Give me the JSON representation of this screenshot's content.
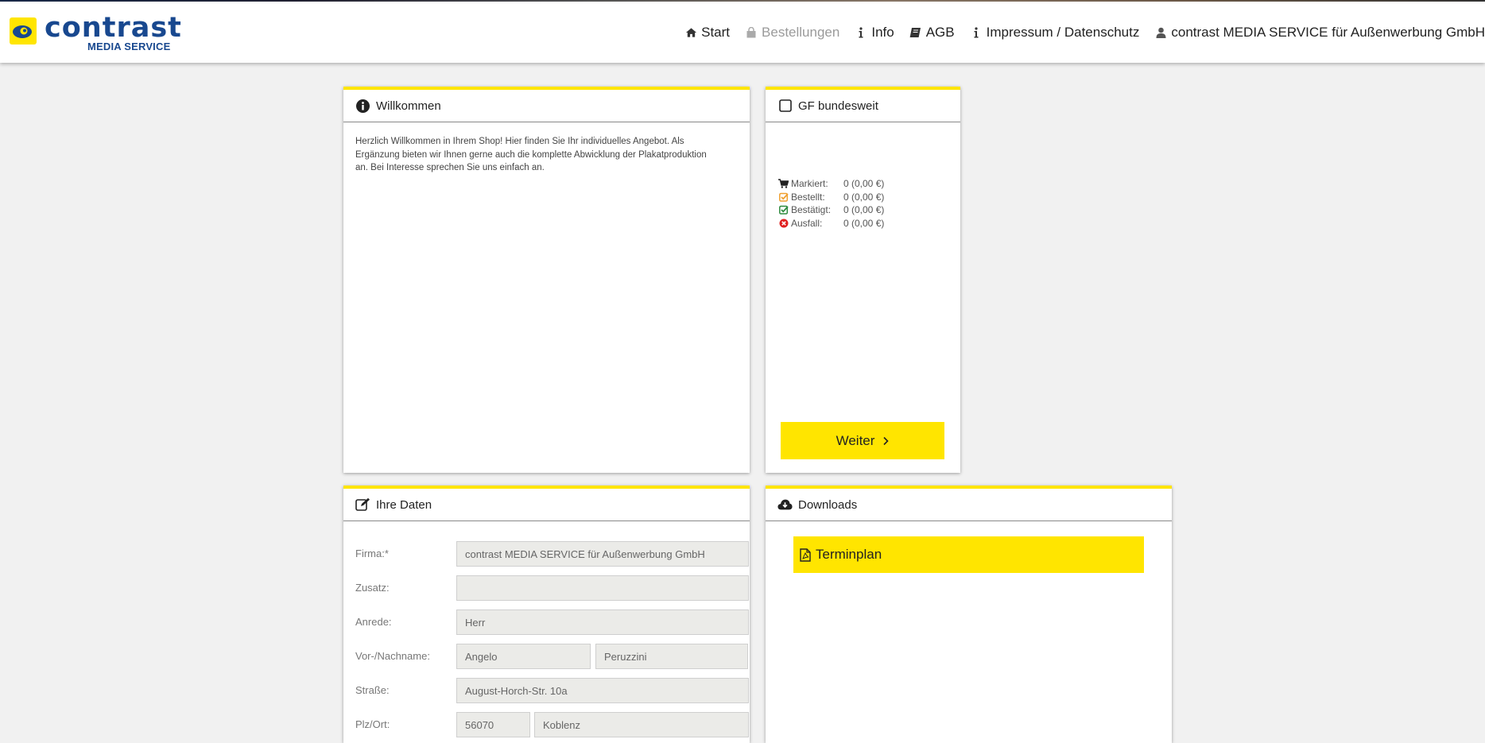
{
  "logo": {
    "word": "contrast",
    "sub": "MEDIA SERVICE"
  },
  "nav": {
    "items": [
      {
        "label": "Start",
        "icon": "home-icon"
      },
      {
        "label": "Bestellungen",
        "icon": "shopping-bag-icon"
      },
      {
        "label": "Info",
        "icon": "info-icon"
      },
      {
        "label": "AGB",
        "icon": "book-icon"
      },
      {
        "label": "Impressum / Datenschutz",
        "icon": "info-icon"
      },
      {
        "label": "contrast MEDIA SERVICE für Außenwerbung GmbH",
        "icon": "user-icon"
      }
    ]
  },
  "welcome": {
    "title": "Willkommen",
    "text": "Herzlich Willkommen in Ihrem Shop! Hier finden Sie Ihr individuelles Angebot. Als Ergänzung bieten wir Ihnen gerne auch die komplette Abwicklung der Plakatproduktion an. Bei Interesse sprechen Sie uns einfach an."
  },
  "gf": {
    "title": "GF bundesweit",
    "status": [
      {
        "label": "Markiert:",
        "value": "0 (0,00 €)",
        "icon": "cart-icon",
        "color": "#222222"
      },
      {
        "label": "Bestellt:",
        "value": "0 (0,00 €)",
        "icon": "check-square-icon",
        "color": "#f0a030"
      },
      {
        "label": "Bestätigt:",
        "value": "0 (0,00 €)",
        "icon": "check-square-icon",
        "color": "#2e8b3e"
      },
      {
        "label": "Ausfall:",
        "value": "0 (0,00 €)",
        "icon": "times-circle-icon",
        "color": "#e02020"
      }
    ],
    "button": "Weiter"
  },
  "ihre_daten": {
    "title": "Ihre Daten",
    "fields": {
      "firma": {
        "label": "Firma:*",
        "value": "contrast MEDIA SERVICE für Außenwerbung GmbH"
      },
      "zusatz": {
        "label": "Zusatz:",
        "value": ""
      },
      "anrede": {
        "label": "Anrede:",
        "value": "Herr"
      },
      "name": {
        "label": "Vor-/Nachname:",
        "first": "Angelo",
        "last": "Peruzzini"
      },
      "strasse": {
        "label": "Straße:",
        "value": "August-Horch-Str. 10a"
      },
      "plzort": {
        "label": "Plz/Ort:",
        "plz": "56070",
        "ort": "Koblenz"
      }
    }
  },
  "downloads": {
    "title": "Downloads",
    "items": [
      {
        "label": "Terminplan",
        "icon": "file-pdf-icon"
      }
    ]
  },
  "colors": {
    "accent": "#ffe500",
    "brand": "#18488f",
    "background": "#f1f1f1"
  }
}
